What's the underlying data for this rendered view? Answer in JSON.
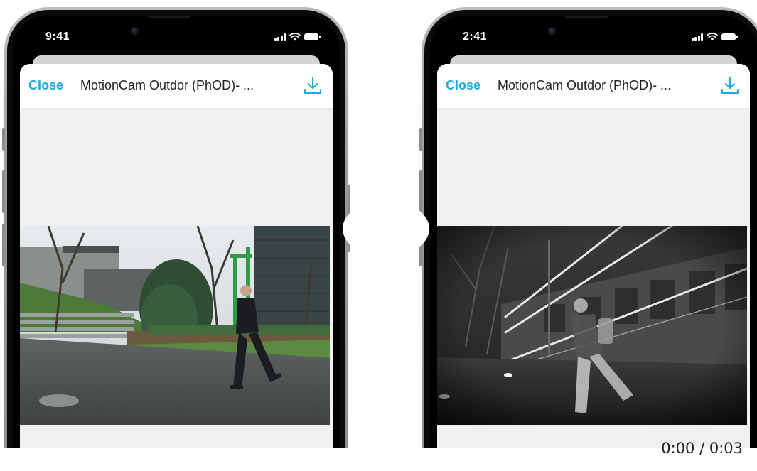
{
  "phones": [
    {
      "status_time": "9:41",
      "close_label": "Close",
      "title": "MotionCam Outdor (PhOD)- ...",
      "video_mode": "day color",
      "icons": [
        "signal-icon",
        "wifi-icon",
        "battery-icon",
        "download-icon"
      ]
    },
    {
      "status_time": "2:41",
      "close_label": "Close",
      "title": "MotionCam Outdor (PhOD)- ...",
      "video_mode": "night infrared",
      "icons": [
        "signal-icon",
        "wifi-icon",
        "battery-icon",
        "download-icon"
      ]
    }
  ],
  "player": {
    "timecode": "0:00 / 0:03"
  },
  "colors": {
    "accent": "#1fa9dc",
    "sheet_background": "#f0f0f0",
    "header_background": "#ffffff",
    "title_text": "#222222"
  }
}
